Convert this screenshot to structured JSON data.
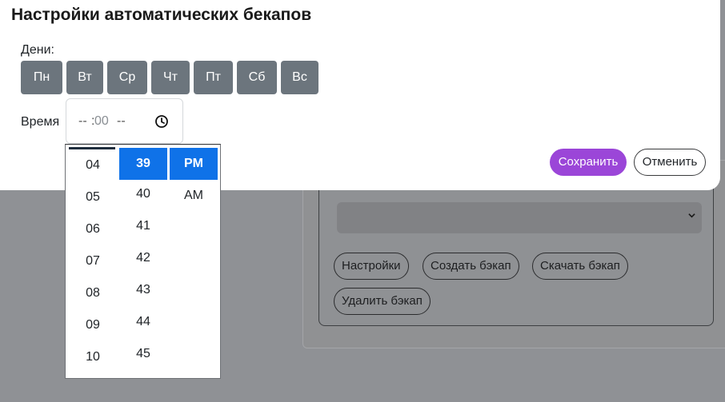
{
  "background": {
    "buttons": [
      "Настройки",
      "Создать бэкап",
      "Скачать бэкап",
      "Удалить бэкап"
    ]
  },
  "modal": {
    "title": "Настройки автоматических бекапов",
    "days_label": "Дени:",
    "days": [
      "Пн",
      "Вт",
      "Ср",
      "Чт",
      "Пт",
      "Сб",
      "Вс"
    ],
    "time_label": "Время",
    "time_input": {
      "hour": "--",
      "colon": ":",
      "minute": "00",
      "ampm": "--",
      "icon": "clock-icon"
    },
    "save_label": "Сохранить",
    "cancel_label": "Отменить"
  },
  "time_picker": {
    "hours": [
      "04",
      "05",
      "06",
      "07",
      "08",
      "09",
      "10"
    ],
    "minutes": [
      "39",
      "40",
      "41",
      "42",
      "43",
      "44",
      "45"
    ],
    "selected_minute": "39",
    "periods": [
      "PM",
      "AM"
    ],
    "selected_period": "PM"
  },
  "colors": {
    "day_button": "#6c757d",
    "save_button": "#9b46d8",
    "picker_selected": "#0f72e8"
  }
}
